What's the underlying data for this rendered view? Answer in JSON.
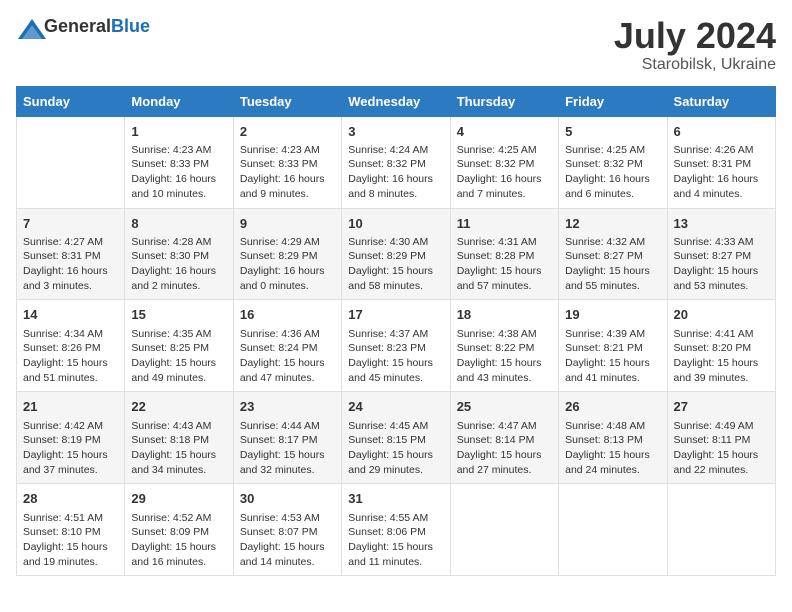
{
  "header": {
    "logo_general": "General",
    "logo_blue": "Blue",
    "title": "July 2024",
    "location": "Starobilsk, Ukraine"
  },
  "columns": [
    "Sunday",
    "Monday",
    "Tuesday",
    "Wednesday",
    "Thursday",
    "Friday",
    "Saturday"
  ],
  "weeks": [
    [
      {
        "day": "",
        "info": ""
      },
      {
        "day": "1",
        "info": "Sunrise: 4:23 AM\nSunset: 8:33 PM\nDaylight: 16 hours\nand 10 minutes."
      },
      {
        "day": "2",
        "info": "Sunrise: 4:23 AM\nSunset: 8:33 PM\nDaylight: 16 hours\nand 9 minutes."
      },
      {
        "day": "3",
        "info": "Sunrise: 4:24 AM\nSunset: 8:32 PM\nDaylight: 16 hours\nand 8 minutes."
      },
      {
        "day": "4",
        "info": "Sunrise: 4:25 AM\nSunset: 8:32 PM\nDaylight: 16 hours\nand 7 minutes."
      },
      {
        "day": "5",
        "info": "Sunrise: 4:25 AM\nSunset: 8:32 PM\nDaylight: 16 hours\nand 6 minutes."
      },
      {
        "day": "6",
        "info": "Sunrise: 4:26 AM\nSunset: 8:31 PM\nDaylight: 16 hours\nand 4 minutes."
      }
    ],
    [
      {
        "day": "7",
        "info": "Sunrise: 4:27 AM\nSunset: 8:31 PM\nDaylight: 16 hours\nand 3 minutes."
      },
      {
        "day": "8",
        "info": "Sunrise: 4:28 AM\nSunset: 8:30 PM\nDaylight: 16 hours\nand 2 minutes."
      },
      {
        "day": "9",
        "info": "Sunrise: 4:29 AM\nSunset: 8:29 PM\nDaylight: 16 hours\nand 0 minutes."
      },
      {
        "day": "10",
        "info": "Sunrise: 4:30 AM\nSunset: 8:29 PM\nDaylight: 15 hours\nand 58 minutes."
      },
      {
        "day": "11",
        "info": "Sunrise: 4:31 AM\nSunset: 8:28 PM\nDaylight: 15 hours\nand 57 minutes."
      },
      {
        "day": "12",
        "info": "Sunrise: 4:32 AM\nSunset: 8:27 PM\nDaylight: 15 hours\nand 55 minutes."
      },
      {
        "day": "13",
        "info": "Sunrise: 4:33 AM\nSunset: 8:27 PM\nDaylight: 15 hours\nand 53 minutes."
      }
    ],
    [
      {
        "day": "14",
        "info": "Sunrise: 4:34 AM\nSunset: 8:26 PM\nDaylight: 15 hours\nand 51 minutes."
      },
      {
        "day": "15",
        "info": "Sunrise: 4:35 AM\nSunset: 8:25 PM\nDaylight: 15 hours\nand 49 minutes."
      },
      {
        "day": "16",
        "info": "Sunrise: 4:36 AM\nSunset: 8:24 PM\nDaylight: 15 hours\nand 47 minutes."
      },
      {
        "day": "17",
        "info": "Sunrise: 4:37 AM\nSunset: 8:23 PM\nDaylight: 15 hours\nand 45 minutes."
      },
      {
        "day": "18",
        "info": "Sunrise: 4:38 AM\nSunset: 8:22 PM\nDaylight: 15 hours\nand 43 minutes."
      },
      {
        "day": "19",
        "info": "Sunrise: 4:39 AM\nSunset: 8:21 PM\nDaylight: 15 hours\nand 41 minutes."
      },
      {
        "day": "20",
        "info": "Sunrise: 4:41 AM\nSunset: 8:20 PM\nDaylight: 15 hours\nand 39 minutes."
      }
    ],
    [
      {
        "day": "21",
        "info": "Sunrise: 4:42 AM\nSunset: 8:19 PM\nDaylight: 15 hours\nand 37 minutes."
      },
      {
        "day": "22",
        "info": "Sunrise: 4:43 AM\nSunset: 8:18 PM\nDaylight: 15 hours\nand 34 minutes."
      },
      {
        "day": "23",
        "info": "Sunrise: 4:44 AM\nSunset: 8:17 PM\nDaylight: 15 hours\nand 32 minutes."
      },
      {
        "day": "24",
        "info": "Sunrise: 4:45 AM\nSunset: 8:15 PM\nDaylight: 15 hours\nand 29 minutes."
      },
      {
        "day": "25",
        "info": "Sunrise: 4:47 AM\nSunset: 8:14 PM\nDaylight: 15 hours\nand 27 minutes."
      },
      {
        "day": "26",
        "info": "Sunrise: 4:48 AM\nSunset: 8:13 PM\nDaylight: 15 hours\nand 24 minutes."
      },
      {
        "day": "27",
        "info": "Sunrise: 4:49 AM\nSunset: 8:11 PM\nDaylight: 15 hours\nand 22 minutes."
      }
    ],
    [
      {
        "day": "28",
        "info": "Sunrise: 4:51 AM\nSunset: 8:10 PM\nDaylight: 15 hours\nand 19 minutes."
      },
      {
        "day": "29",
        "info": "Sunrise: 4:52 AM\nSunset: 8:09 PM\nDaylight: 15 hours\nand 16 minutes."
      },
      {
        "day": "30",
        "info": "Sunrise: 4:53 AM\nSunset: 8:07 PM\nDaylight: 15 hours\nand 14 minutes."
      },
      {
        "day": "31",
        "info": "Sunrise: 4:55 AM\nSunset: 8:06 PM\nDaylight: 15 hours\nand 11 minutes."
      },
      {
        "day": "",
        "info": ""
      },
      {
        "day": "",
        "info": ""
      },
      {
        "day": "",
        "info": ""
      }
    ]
  ]
}
